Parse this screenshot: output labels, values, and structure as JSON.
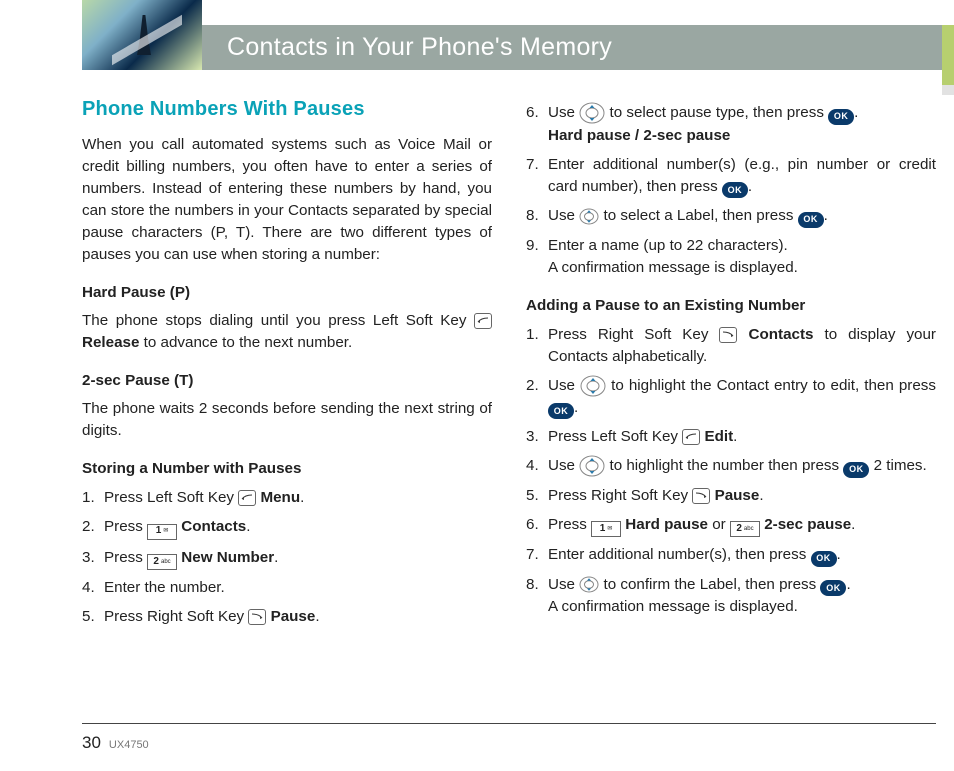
{
  "header": {
    "title": "Contacts in Your Phone's Memory"
  },
  "section_title": "Phone Numbers With Pauses",
  "intro": "When you call automated systems such as Voice Mail or credit billing numbers, you often have to enter a series of numbers. Instead of entering these numbers by hand, you can store the numbers in your Contacts separated by special pause characters (P, T). There are two different types of pauses you can use when storing a number:",
  "hard_pause": {
    "heading": "Hard Pause (P)",
    "text_a": "The phone stops dialing until you press Left Soft Key ",
    "text_b": " ",
    "release": "Release",
    "text_c": " to advance to the next number."
  },
  "two_sec": {
    "heading": "2-sec Pause (T)",
    "text": "The phone waits 2 seconds before sending the next string of digits."
  },
  "storing": {
    "heading": "Storing a Number with Pauses",
    "s1a": "Press Left Soft Key ",
    "s1b": " ",
    "s1menu": "Menu",
    "s1c": ".",
    "s2a": "Press ",
    "s2key": "1",
    "s2contacts": "Contacts",
    "s2c": ".",
    "s3a": "Press ",
    "s3key": "2",
    "s3new": "New Number",
    "s3c": ".",
    "s4": "Enter the number.",
    "s5a": "Press Right Soft Key ",
    "s5pause": "Pause",
    "s5c": "."
  },
  "right": {
    "s6a": "Use ",
    "s6b": " to select pause type, then press ",
    "s6c": ".",
    "s6d": "Hard pause / 2-sec pause",
    "s7a": "Enter additional number(s) (e.g., pin number or credit card number), then press ",
    "s7b": ".",
    "s8a": "Use ",
    "s8b": " to select a Label, then press ",
    "s8c": ".",
    "s9a": "Enter a name (up to 22 characters).",
    "s9b": "A confirmation message is displayed."
  },
  "adding": {
    "heading": "Adding a Pause to an Existing Number",
    "a1a": "Press Right Soft Key ",
    "a1b": " ",
    "a1contacts": "Contacts",
    "a1c": " to display your Contacts alphabetically.",
    "a2a": "Use ",
    "a2b": " to highlight the Contact entry to edit, then press ",
    "a2c": ".",
    "a3a": "Press Left Soft Key ",
    "a3edit": "Edit",
    "a3b": ".",
    "a4a": "Use ",
    "a4b": " to highlight the number then press ",
    "a4c": " 2 times.",
    "a5a": "Press Right Soft Key ",
    "a5pause": "Pause",
    "a5b": ".",
    "a6a": "Press ",
    "a6k1": "1",
    "a6hp": "Hard pause",
    "a6or": " or ",
    "a6k2": "2",
    "a6sp": "2-sec pause",
    "a6b": ".",
    "a7a": "Enter additional number(s), then press ",
    "a7b": ".",
    "a8a": "Use ",
    "a8b": " to confirm the Label, then press ",
    "a8c": ".",
    "a8d": "A confirmation message is displayed."
  },
  "keys": {
    "ok": "OK",
    "abc": "abc"
  },
  "footer": {
    "page": "30",
    "model": "UX4750"
  }
}
